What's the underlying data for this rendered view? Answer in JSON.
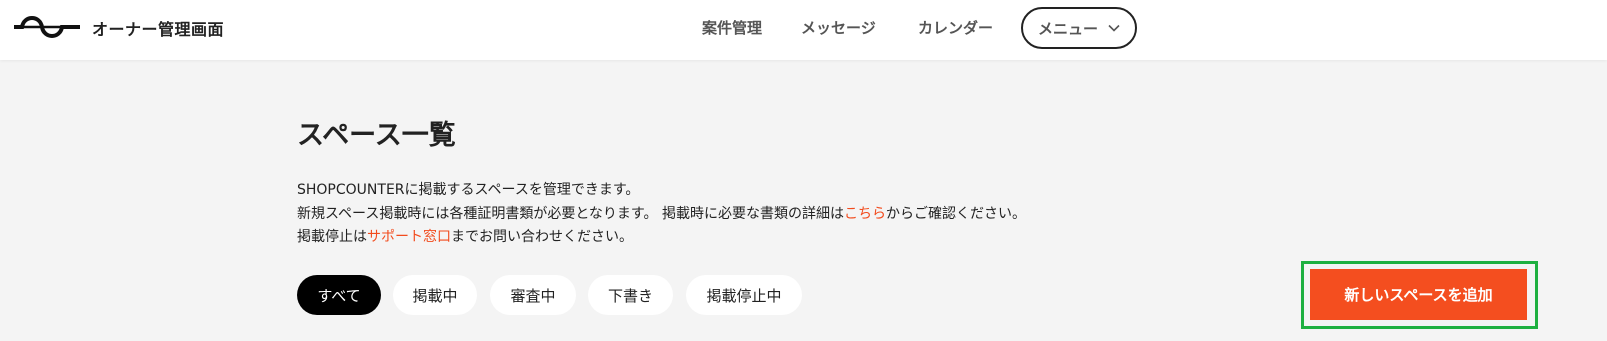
{
  "header": {
    "brand": "オーナー管理画面",
    "nav": [
      {
        "label": "案件管理"
      },
      {
        "label": "メッセージ"
      },
      {
        "label": "カレンダー"
      }
    ],
    "menu_label": "メニュー",
    "logo_icon": "wave-logo-icon",
    "menu_icon": "chevron-down-icon"
  },
  "main": {
    "title": "スペース一覧",
    "description": {
      "line1": "SHOPCOUNTERに掲載するスペースを管理できます。",
      "line2_prefix": "新規スペース掲載時には各種証明書類が必要となります。 掲載時に必要な書類の詳細は",
      "line2_link": "こちら",
      "line2_suffix": "からご確認ください。",
      "line3_prefix": "掲載停止は",
      "line3_link": "サポート窓口",
      "line3_suffix": "までお問い合わせください。"
    },
    "filters": [
      {
        "label": "すべて",
        "active": true
      },
      {
        "label": "掲載中",
        "active": false
      },
      {
        "label": "審査中",
        "active": false
      },
      {
        "label": "下書き",
        "active": false
      },
      {
        "label": "掲載停止中",
        "active": false
      }
    ],
    "add_button_label": "新しいスペースを追加"
  },
  "colors": {
    "accent": "#f44e1f",
    "link": "#f24b1d",
    "highlight_border": "#1eb040",
    "page_background": "#f4f4f4"
  }
}
